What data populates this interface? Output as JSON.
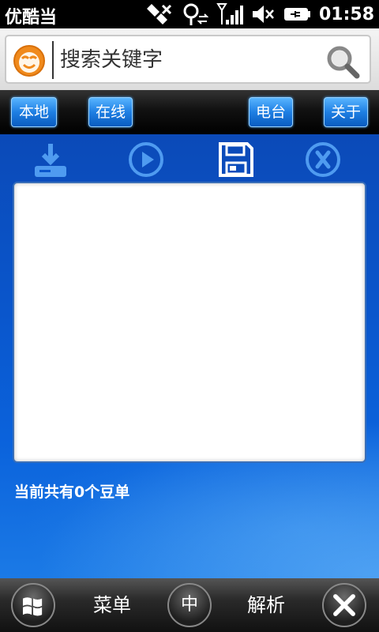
{
  "status_bar": {
    "app_title": "优酷当",
    "time": "01:58",
    "icons": [
      "satellite-off-icon",
      "location-sync-icon",
      "signal-icon",
      "volume-muted-icon",
      "battery-charging-icon"
    ]
  },
  "search": {
    "placeholder": "搜索关键字",
    "logo_icon": "youku-face-logo",
    "search_icon": "magnifier-icon"
  },
  "toolbar": {
    "local_label": "本地",
    "online_label": "在线",
    "radio_label": "电台",
    "about_label": "关于"
  },
  "actions": {
    "icons": [
      "download-icon",
      "play-icon",
      "save-icon",
      "delete-icon"
    ]
  },
  "main": {
    "status_text": "当前共有0个豆单"
  },
  "bottom_bar": {
    "start_icon": "windows-flag-icon",
    "menu_label": "菜单",
    "ime_label": "中",
    "parse_label": "解析",
    "close_icon": "close-icon"
  },
  "colors": {
    "accent": "#1e7fe3",
    "background_blue": "#0a56cc",
    "orange_logo": "#f08a1c"
  }
}
